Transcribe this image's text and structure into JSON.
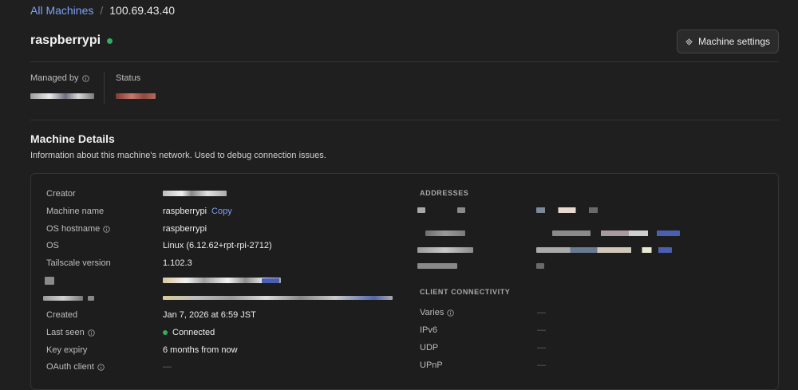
{
  "breadcrumb": {
    "root": "All Machines",
    "separator": "/",
    "current": "100.69.43.40"
  },
  "machine": {
    "name": "raspberrypi",
    "status_color": "#2fae62"
  },
  "header": {
    "settings_label": "Machine settings"
  },
  "meta": {
    "managed_by_label": "Managed by",
    "status_label": "Status"
  },
  "details": {
    "title": "Machine Details",
    "subtitle": "Information about this machine's network. Used to debug connection issues.",
    "fields": {
      "creator": "Creator",
      "machine_name_label": "Machine name",
      "machine_name_value": "raspberrypi",
      "copy": "Copy",
      "os_hostname_label": "OS hostname",
      "os_hostname_value": "raspberrypi",
      "os_label": "OS",
      "os_value": "Linux (6.12.62+rpt-rpi-2712)",
      "tailscale_label": "Tailscale version",
      "tailscale_value": "1.102.3",
      "created_label": "Created",
      "created_value": "Jan 7, 2026 at 6:59 JST",
      "last_seen_label": "Last seen",
      "last_seen_value": "Connected",
      "key_expiry_label": "Key expiry",
      "key_expiry_value": "6 months from now",
      "oauth_label": "OAuth client",
      "oauth_value": "—"
    },
    "addresses_title": "ADDRESSES",
    "connectivity_title": "CLIENT CONNECTIVITY",
    "connectivity": {
      "varies": "Varies",
      "ipv6": "IPv6",
      "udp": "UDP",
      "upnp": "UPnP",
      "dash": "—"
    }
  }
}
